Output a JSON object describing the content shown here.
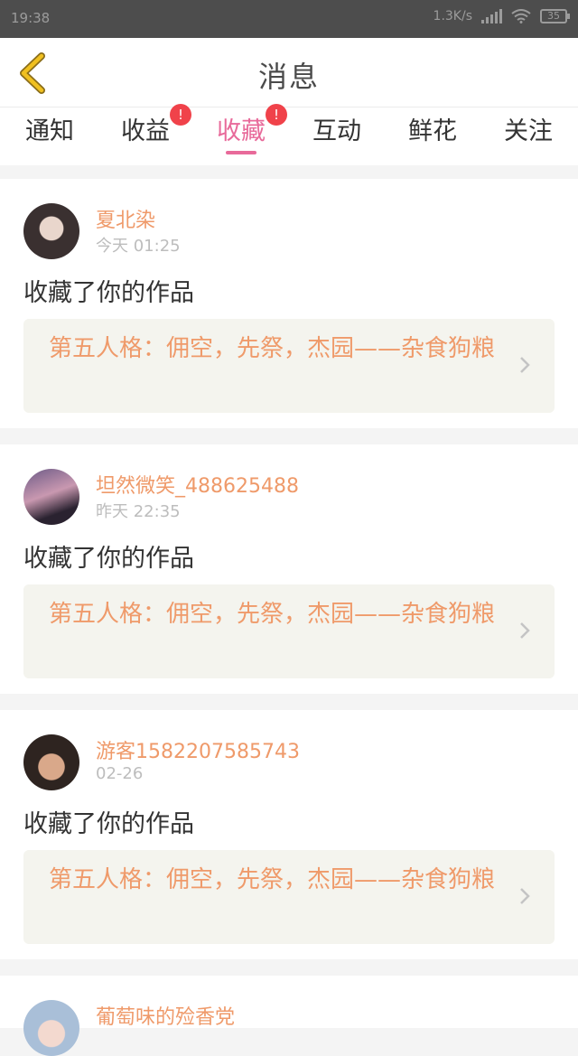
{
  "status_bar": {
    "time": "19:38",
    "network_speed": "1.3K/s",
    "battery": "35"
  },
  "header": {
    "title": "消息"
  },
  "tabs": [
    {
      "label": "通知"
    },
    {
      "label": "收益",
      "badge": "!"
    },
    {
      "label": "收藏",
      "badge": "!",
      "active": true
    },
    {
      "label": "互动"
    },
    {
      "label": "鲜花"
    },
    {
      "label": "关注"
    }
  ],
  "messages": [
    {
      "user": "夏北染",
      "time": "今天 01:25",
      "action": "收藏了你的作品",
      "work_title": "第五人格：佣空，先祭，杰园——杂食狗粮"
    },
    {
      "user": "坦然微笑_488625488",
      "time": "昨天 22:35",
      "action": "收藏了你的作品",
      "work_title": "第五人格：佣空，先祭，杰园——杂食狗粮"
    },
    {
      "user": "游客1582207585743",
      "time": "02-26",
      "action": "收藏了你的作品",
      "work_title": "第五人格：佣空，先祭，杰园——杂食狗粮"
    },
    {
      "user": "葡萄味的殓香党"
    }
  ],
  "colors": {
    "accent_pink": "#e86a9a",
    "username_orange": "#ef9a6a",
    "badge_red": "#f0424a",
    "back_yellow": "#f0c020"
  }
}
